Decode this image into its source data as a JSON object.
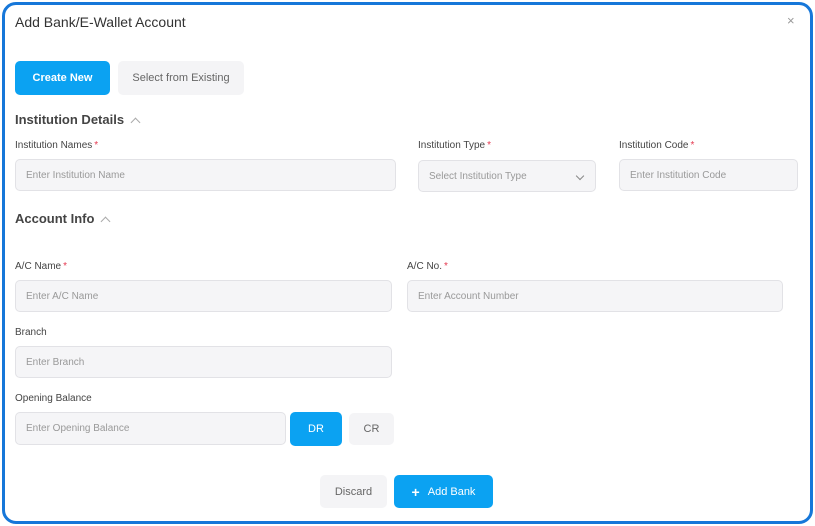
{
  "dialog": {
    "title": "Add Bank/E-Wallet Account",
    "close": "×"
  },
  "mode_tabs": {
    "create_new": "Create New",
    "select_existing": "Select from Existing"
  },
  "institution_section": {
    "title": "Institution Details",
    "name_label": "Institution Names",
    "name_placeholder": "Enter Institution Name",
    "type_label": "Institution Type",
    "type_placeholder": "Select Institution Type",
    "code_label": "Institution Code",
    "code_placeholder": "Enter Institution Code"
  },
  "account_section": {
    "title": "Account Info",
    "ac_name_label": "A/C Name",
    "ac_name_placeholder": "Enter A/C Name",
    "ac_no_label": "A/C No.",
    "ac_no_placeholder": "Enter Account Number",
    "branch_label": "Branch",
    "branch_placeholder": "Enter Branch",
    "balance_label": "Opening Balance",
    "balance_placeholder": "Enter Opening Balance",
    "dr": "DR",
    "cr": "CR"
  },
  "required_mark": "*",
  "footer": {
    "discard": "Discard",
    "add_bank_icon": "+",
    "add_bank": "Add Bank"
  },
  "colors": {
    "border": "#1677d9",
    "primary": "#0ba2f2",
    "required": "#e53950"
  }
}
